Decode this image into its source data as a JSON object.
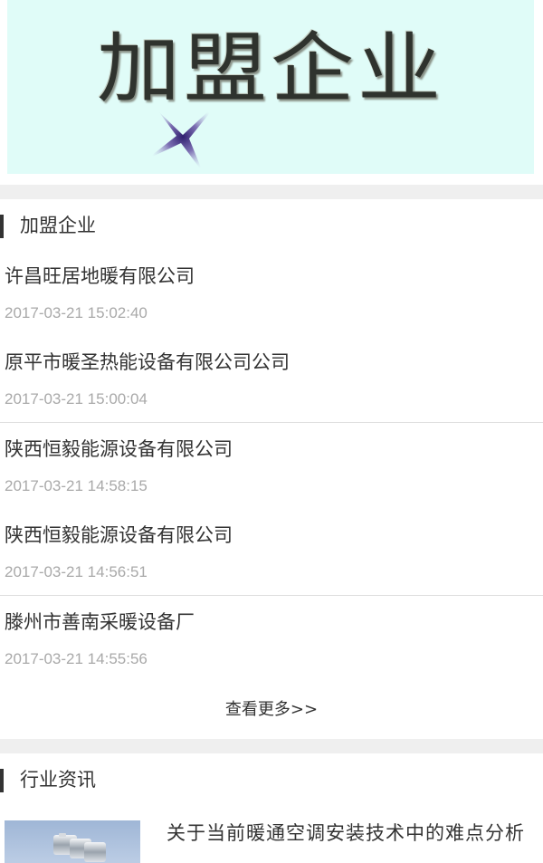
{
  "banner": {
    "title": "加盟企业"
  },
  "franchise": {
    "heading": "加盟企业",
    "items": [
      {
        "name": "许昌旺居地暖有限公司",
        "time": "2017-03-21 15:02:40"
      },
      {
        "name": "原平市暖圣热能设备有限公司公司",
        "time": "2017-03-21 15:00:04"
      },
      {
        "name": "陕西恒毅能源设备有限公司",
        "time": "2017-03-21 14:58:15"
      },
      {
        "name": "陕西恒毅能源设备有限公司",
        "time": "2017-03-21 14:56:51"
      },
      {
        "name": "滕州市善南采暖设备厂",
        "time": "2017-03-21 14:55:56"
      }
    ],
    "more_label": "查看更多>>"
  },
  "news": {
    "heading": "行业资讯",
    "items": [
      {
        "title": "关于当前暖通空调安装技术中的难点分析"
      }
    ]
  },
  "colors": {
    "banner_bg": "#e0fcf8",
    "separator": "#efefef",
    "time_text": "#a9a9a9",
    "heading_bar": "#333333"
  }
}
